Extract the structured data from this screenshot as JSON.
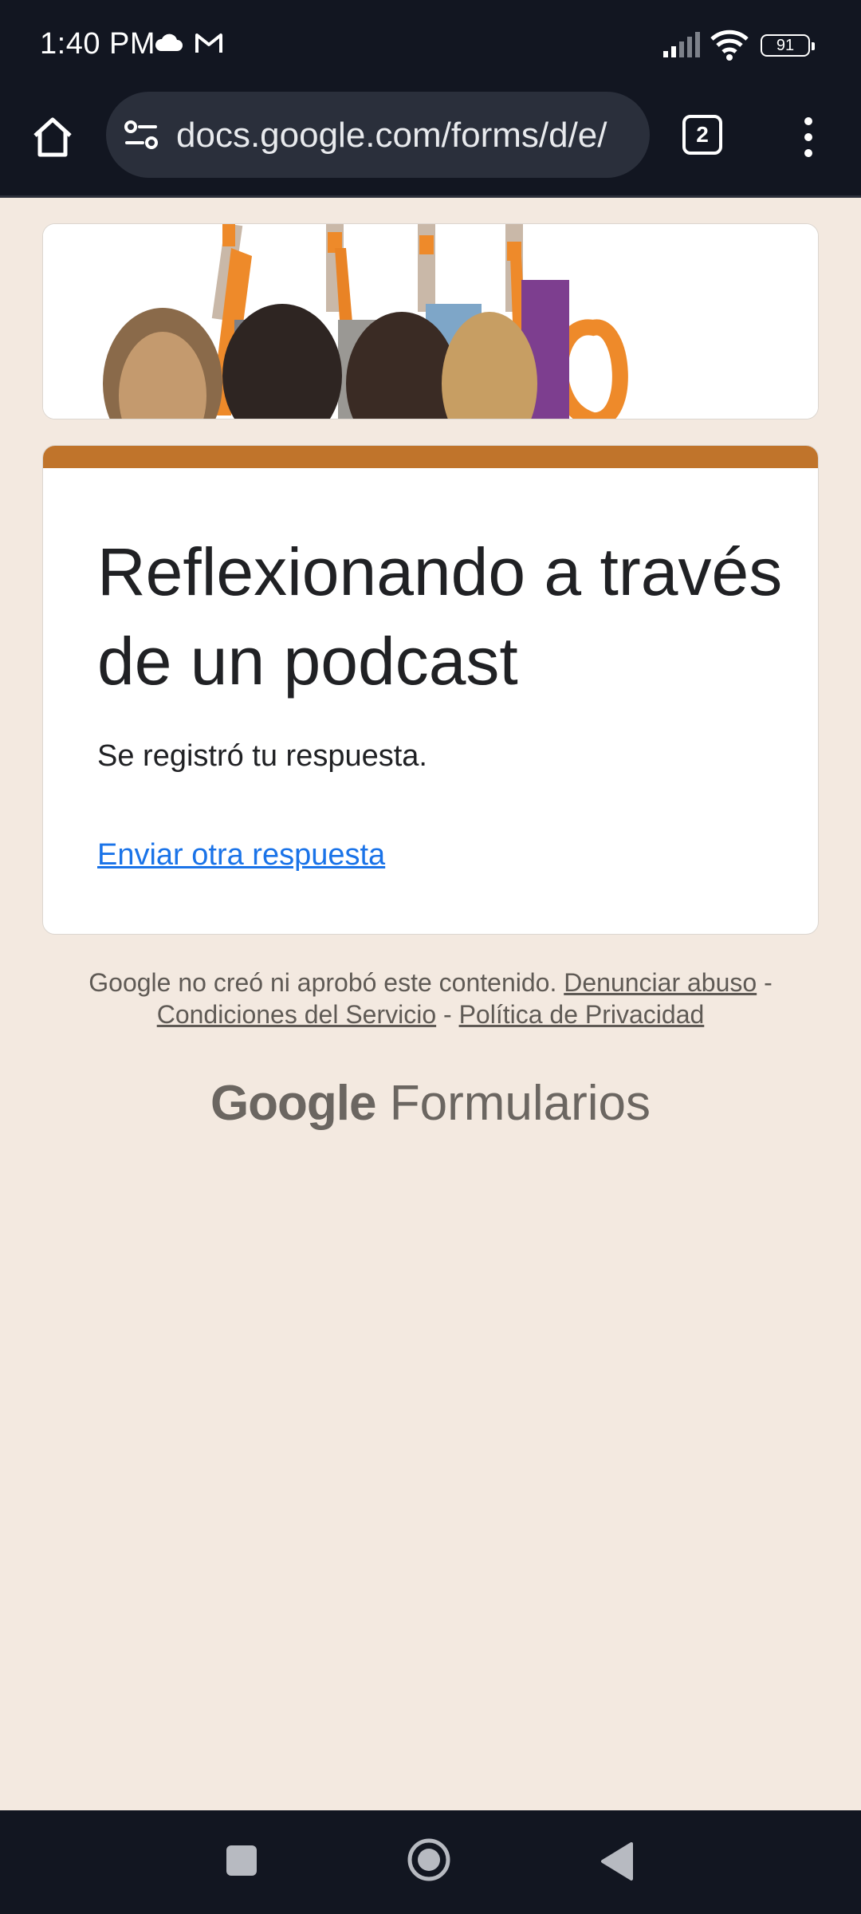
{
  "status_bar": {
    "time": "1:40 PM",
    "battery": "91",
    "icons": [
      "cloud-icon",
      "gmail-icon",
      "signal-icon",
      "wifi-icon",
      "battery-icon"
    ]
  },
  "browser": {
    "url": "docs.google.com/forms/d/e/",
    "tab_count": "2"
  },
  "form": {
    "title": "Reflexionando a través de un podcast",
    "confirmation": "Se registró tu respuesta.",
    "another_response_link": "Enviar otra respuesta",
    "accent_color": "#c0742b"
  },
  "footer": {
    "disclaimer": "Google no creó ni aprobó este contenido.",
    "report_abuse": "Denunciar abuso",
    "separator": "-",
    "terms": "Condiciones del Servicio",
    "privacy": "Política de Privacidad",
    "brand_google": "Google",
    "brand_product": "Formularios"
  },
  "colors": {
    "page_background": "#f3e9e0",
    "system_bar": "#121621",
    "link": "#1a73e8"
  }
}
